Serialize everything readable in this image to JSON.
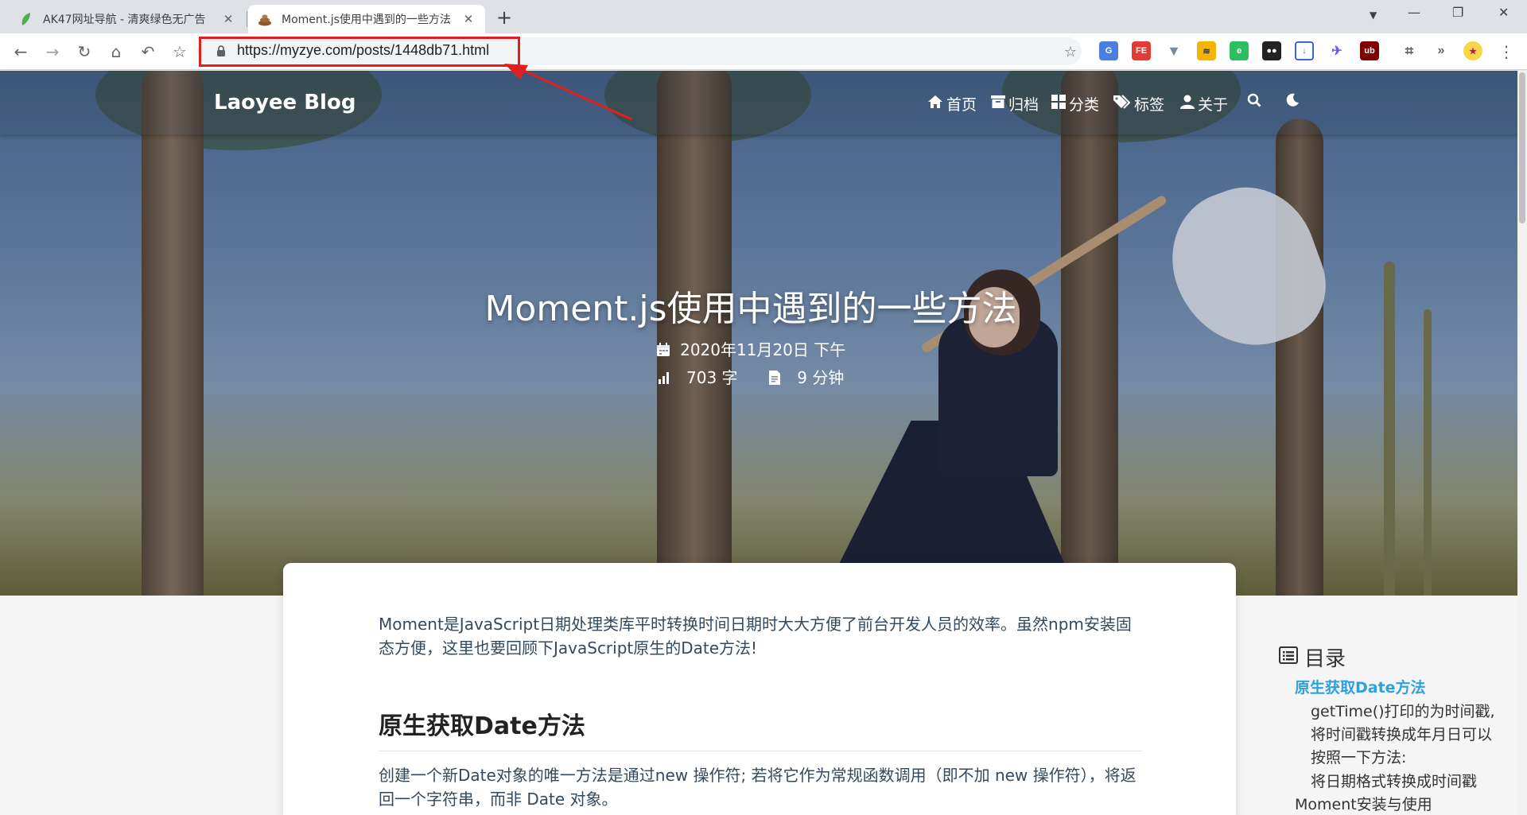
{
  "browser": {
    "tabs": [
      {
        "title": "AK47网址导航 - 清爽绿色无广告",
        "active": false,
        "favicon": "leaf-icon"
      },
      {
        "title": "Moment.js使用中遇到的一些方法",
        "active": true,
        "favicon": "poop-icon"
      }
    ],
    "url": "https://myzye.com/posts/1448db71.html",
    "url_highlight_color": "#e02020",
    "extensions": [
      "translate-icon",
      "fe-icon",
      "vue-devtools-icon",
      "rss-icon",
      "evernote-icon",
      "tampermonkey-icon",
      "save-icon",
      "feather-icon",
      "ublock-icon",
      "crop-icon",
      "chevrons-icon",
      "avatar-icon"
    ]
  },
  "site": {
    "logo": "Laoyee Blog",
    "menu": [
      {
        "label": "首页",
        "icon": "home-icon"
      },
      {
        "label": "归档",
        "icon": "archive-icon"
      },
      {
        "label": "分类",
        "icon": "category-icon"
      },
      {
        "label": "标签",
        "icon": "tags-icon"
      },
      {
        "label": "关于",
        "icon": "user-icon"
      }
    ]
  },
  "post": {
    "title": "Moment.js使用中遇到的一些方法",
    "date": "2020年11月20日 下午",
    "word_count": "703 字",
    "read_time": "9 分钟",
    "intro": "Moment是JavaScript日期处理类库平时转换时间日期时大大方便了前台开发人员的效率。虽然npm安装固态方便，这里也要回顾下JavaScript原生的Date方法!",
    "heading": "原生获取Date方法",
    "paragraph": "创建一个新Date对象的唯一方法是通过new 操作符; 若将它作为常规函数调用（即不加 new 操作符），将返回一个字符串，而非 Date 对象。"
  },
  "toc": {
    "title": "目录",
    "items": [
      {
        "text": "原生获取Date方法",
        "active": true
      },
      {
        "text": "getTime()打印的为时间戳,",
        "active": false
      },
      {
        "text": "将时间戳转换成年月日可以",
        "active": false
      },
      {
        "text": "按照一下方法:",
        "active": false
      },
      {
        "text": "将日期格式转换成时间戳",
        "active": false
      },
      {
        "text": "Moment安装与使用",
        "active": false
      }
    ]
  },
  "colors": {
    "accent": "#2ea0e0",
    "title_text": "#ffffff"
  }
}
